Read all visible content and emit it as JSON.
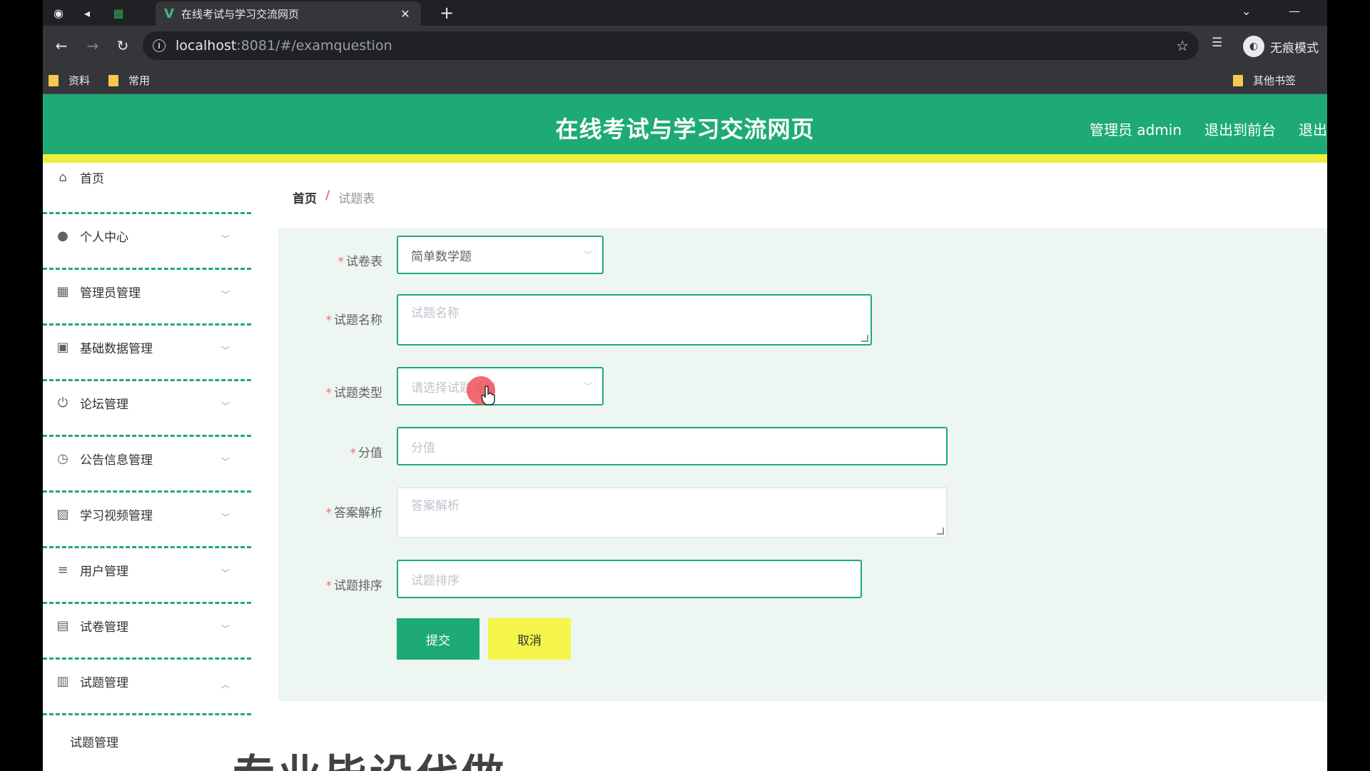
{
  "browser": {
    "tab_title": "在线考试与学习交流网页",
    "url_host": "localhost",
    "url_path": ":8081/#/examquestion",
    "profile_label": "无痕模式",
    "bookmarks": [
      "资料",
      "常用"
    ],
    "other_bookmarks": "其他书签"
  },
  "header": {
    "title": "在线考试与学习交流网页",
    "user_label": "管理员 admin",
    "to_front": "退出到前台",
    "logout": "退出"
  },
  "sidebar": {
    "items": [
      {
        "label": "首页",
        "icon": "home-icon"
      },
      {
        "label": "个人中心",
        "icon": "user-icon"
      },
      {
        "label": "管理员管理",
        "icon": "grid-icon"
      },
      {
        "label": "基础数据管理",
        "icon": "clipboard-icon"
      },
      {
        "label": "论坛管理",
        "icon": "power-icon"
      },
      {
        "label": "公告信息管理",
        "icon": "clock-icon"
      },
      {
        "label": "学习视频管理",
        "icon": "chart-icon"
      },
      {
        "label": "用户管理",
        "icon": "list-icon"
      },
      {
        "label": "试卷管理",
        "icon": "message-icon"
      },
      {
        "label": "试题管理",
        "icon": "printer-icon"
      }
    ],
    "submenu_item": "试题管理"
  },
  "breadcrumb": {
    "home": "首页",
    "separator": "/",
    "current": "试题表"
  },
  "form": {
    "paper": {
      "label": "试卷表",
      "value": "简单数学题"
    },
    "name": {
      "label": "试题名称",
      "placeholder": "试题名称"
    },
    "type": {
      "label": "试题类型",
      "placeholder": "请选择试题类型"
    },
    "score": {
      "label": "分值",
      "placeholder": "分值"
    },
    "analysis": {
      "label": "答案解析",
      "placeholder": "答案解析"
    },
    "order": {
      "label": "试题排序",
      "placeholder": "试题排序"
    },
    "submit_label": "提交",
    "cancel_label": "取消"
  },
  "colors": {
    "primary": "#1eaa75",
    "accent_yellow": "#e9ef3c",
    "form_bg": "#edf6f1"
  },
  "overlay_text": "专业毕设代做"
}
